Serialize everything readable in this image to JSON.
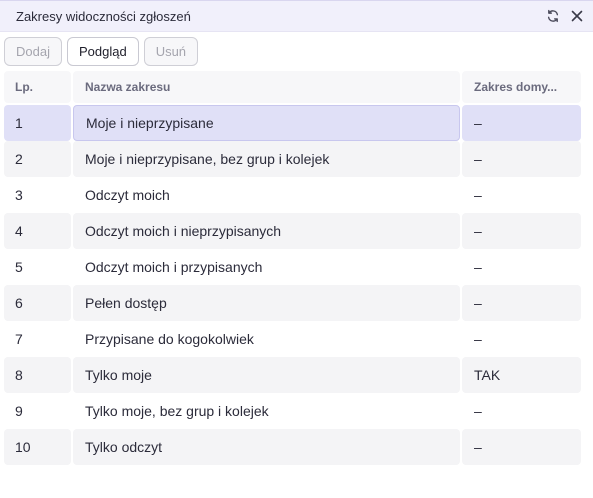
{
  "window": {
    "title": "Zakresy widoczności zgłoszeń",
    "refresh_icon": "refresh-icon",
    "close_icon": "close-icon"
  },
  "toolbar": {
    "add_label": "Dodaj",
    "preview_label": "Podgląd",
    "delete_label": "Usuń"
  },
  "table": {
    "columns": [
      "Lp.",
      "Nazwa zakresu",
      "Zakres domy..."
    ],
    "rows": [
      {
        "lp": "1",
        "name": "Moje i nieprzypisane",
        "default": "–"
      },
      {
        "lp": "2",
        "name": "Moje i nieprzypisane, bez grup i kolejek",
        "default": "–"
      },
      {
        "lp": "3",
        "name": "Odczyt moich",
        "default": "–"
      },
      {
        "lp": "4",
        "name": "Odczyt moich i nieprzypisanych",
        "default": "–"
      },
      {
        "lp": "5",
        "name": "Odczyt moich i przypisanych",
        "default": "–"
      },
      {
        "lp": "6",
        "name": "Pełen dostęp",
        "default": "–"
      },
      {
        "lp": "7",
        "name": "Przypisane do kogokolwiek",
        "default": "–"
      },
      {
        "lp": "8",
        "name": "Tylko moje",
        "default": "TAK"
      },
      {
        "lp": "9",
        "name": "Tylko moje, bez grup i kolejek",
        "default": "–"
      },
      {
        "lp": "10",
        "name": "Tylko odczyt",
        "default": "–"
      }
    ],
    "selected_row": "1"
  },
  "colors": {
    "titlebar_bg": "#f1f0fb",
    "selected_row_bg": "#e0e0f7",
    "alt_row_bg": "#f4f4f6",
    "accent": "#6a63c9"
  }
}
